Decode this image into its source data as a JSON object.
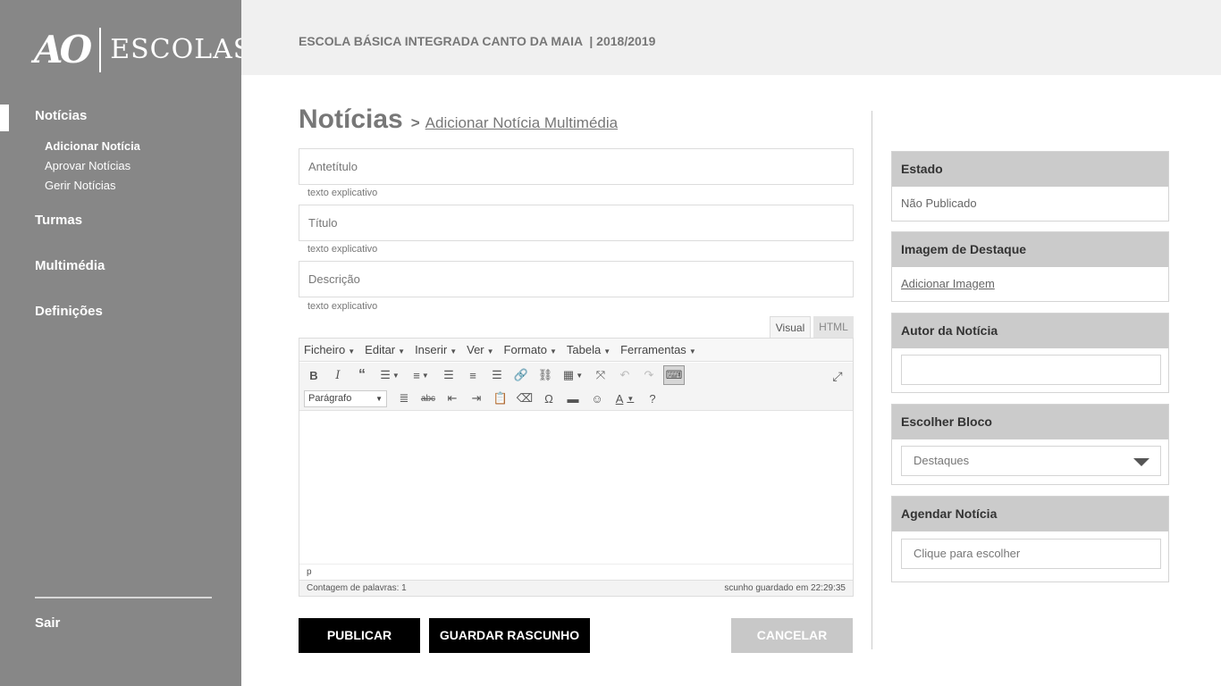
{
  "brand": {
    "logo_mark": "AO",
    "logo_text": "ESCOLAS"
  },
  "header": {
    "title": "ESCOLA BÁSICA INTEGRADA CANTO DA MAIA  | 2018/2019"
  },
  "sidebar": {
    "items": [
      {
        "label": "Notícias"
      },
      {
        "label": "Turmas"
      },
      {
        "label": "Multimédia"
      },
      {
        "label": "Definições"
      }
    ],
    "subitems": [
      {
        "label": "Adicionar Notícia"
      },
      {
        "label": "Aprovar Notícias"
      },
      {
        "label": "Gerir Notícias"
      }
    ],
    "logout": "Sair"
  },
  "page": {
    "title": "Notícias",
    "separator": ">",
    "subtitle": "Adicionar Notícia Multimédia"
  },
  "form": {
    "antetitulo": {
      "placeholder": "Antetítulo",
      "hint": "texto explicativo"
    },
    "titulo": {
      "placeholder": "Título",
      "hint": "texto explicativo"
    },
    "descricao": {
      "placeholder": "Descrição",
      "hint": "texto explicativo"
    }
  },
  "editor": {
    "tabs": {
      "visual": "Visual",
      "html": "HTML"
    },
    "menus": [
      "Ficheiro",
      "Editar",
      "Inserir",
      "Ver",
      "Formato",
      "Tabela",
      "Ferramentas"
    ],
    "format_select": "Parágrafo",
    "path": "p",
    "word_count": "Contagem de palavras: 1",
    "draft_saved": "scunho guardado em 22:29:35"
  },
  "buttons": {
    "publish": "PUBLICAR",
    "draft": "GUARDAR RASCUNHO",
    "cancel": "CANCELAR"
  },
  "panels": {
    "estado": {
      "title": "Estado",
      "value": "Não Publicado"
    },
    "imagem": {
      "title": "Imagem de Destaque",
      "link": "Adicionar Imagem"
    },
    "autor": {
      "title": "Autor da Notícia",
      "value": ""
    },
    "bloco": {
      "title": "Escolher Bloco",
      "selected": "Destaques"
    },
    "agendar": {
      "title": "Agendar Notícia",
      "placeholder": "Clique para escolher"
    }
  }
}
